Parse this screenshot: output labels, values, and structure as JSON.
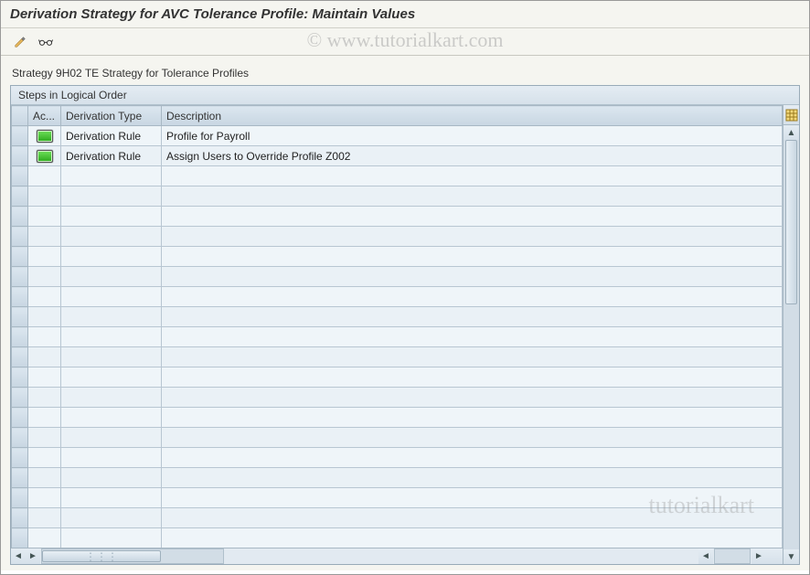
{
  "title": "Derivation Strategy for AVC Tolerance Profile: Maintain Values",
  "toolbar": {
    "edit_tooltip": "Display/Change",
    "glasses_tooltip": "Display"
  },
  "strategy_line": "Strategy 9H02 TE Strategy for Tolerance Profiles",
  "panel": {
    "title": "Steps in Logical Order",
    "columns": {
      "active": "Ac...",
      "type": "Derivation Type",
      "description": "Description"
    },
    "rows": [
      {
        "active": true,
        "type": "Derivation Rule",
        "description": "Profile for Payroll"
      },
      {
        "active": true,
        "type": "Derivation Rule",
        "description": "Assign Users to Override Profile Z002"
      }
    ],
    "empty_row_count": 20
  },
  "watermark": "© www.tutorialkart.com",
  "watermark2": "tutorialkart"
}
